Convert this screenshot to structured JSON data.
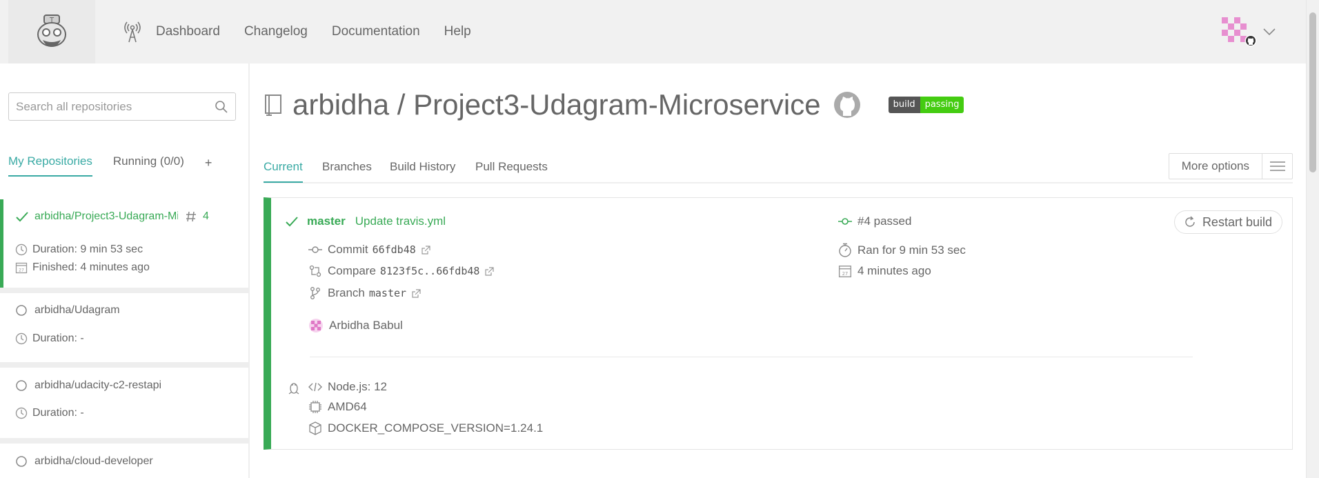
{
  "nav": {
    "links": [
      "Dashboard",
      "Changelog",
      "Documentation",
      "Help"
    ]
  },
  "sidebar": {
    "search_placeholder": "Search all repositories",
    "tabs": {
      "my_repositories": "My Repositories",
      "running": "Running (0/0)",
      "add": "+"
    },
    "repos": [
      {
        "name": "arbidha/Project3-Udagram-Microservice",
        "build_number": "4",
        "duration": "Duration: 9 min 53 sec",
        "finished": "Finished: 4 minutes ago",
        "status": "passed"
      },
      {
        "name": "arbidha/Udagram",
        "duration": "Duration: -",
        "status": "none"
      },
      {
        "name": "arbidha/udacity-c2-restapi",
        "duration": "Duration: -",
        "status": "none"
      },
      {
        "name": "arbidha/cloud-developer",
        "status": "none"
      }
    ]
  },
  "repo": {
    "title": "arbidha / Project3-Udagram-Microservice",
    "badge_left": "build",
    "badge_right": "passing"
  },
  "main_tabs": [
    "Current",
    "Branches",
    "Build History",
    "Pull Requests"
  ],
  "more_options": "More options",
  "build": {
    "branch": "master",
    "message": "Update travis.yml",
    "number_status": "#4 passed",
    "restart_label": "Restart build",
    "commit_label": "Commit",
    "commit_sha": "66fdb48",
    "compare_label": "Compare",
    "compare_range": "8123f5c..66fdb48",
    "branch_label": "Branch",
    "branch_name": "master",
    "author": "Arbidha Babul",
    "ran_for": "Ran for 9 min 53 sec",
    "finished_ago": "4 minutes ago",
    "language": "Node.js: 12",
    "arch": "AMD64",
    "env": "DOCKER_COMPOSE_VERSION=1.24.1"
  },
  "colors": {
    "passed": "#39aa56",
    "accent": "#39aaa4",
    "badge_left": "#555555",
    "badge_right": "#44cc11"
  }
}
